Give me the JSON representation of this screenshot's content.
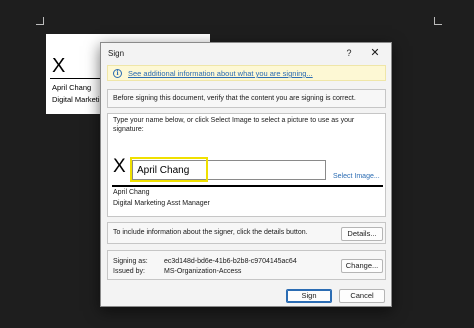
{
  "document": {
    "x_mark": "X",
    "signer_name": "April Chang",
    "signer_title": "Digital Marketi"
  },
  "dialog": {
    "title": "Sign",
    "help_label": "?",
    "close_label": "✕",
    "info_icon": "info-icon",
    "info_glyph": "i",
    "info_link": "See additional information about what you are signing...",
    "verify_text": "Before signing this document, verify that the content you are signing is correct.",
    "instruction_line1": "Type your name below, or click Select Image to select a picture to use as your",
    "instruction_line2": "signature:",
    "x_mark": "X",
    "signature_value": "April Chang",
    "select_image_label": "Select Image...",
    "suggested_signer": "April Chang",
    "suggested_title": "Digital Marketing Asst Manager",
    "details_text": "To include information about the signer, click the details button.",
    "details_button": "Details...",
    "signing_as_label": "Signing as:",
    "signing_as_value": "ec3d148d-bd6e-41b6-b2b8-c9704145ac64",
    "issued_by_label": "Issued by:",
    "issued_by_value": "MS-Organization-Access",
    "change_button": "Change...",
    "sign_button": "Sign",
    "cancel_button": "Cancel"
  },
  "colors": {
    "background": "#1e1e1e",
    "link": "#2b6cb3",
    "highlight": "#f0e000",
    "infobar": "#fdf8d4"
  }
}
